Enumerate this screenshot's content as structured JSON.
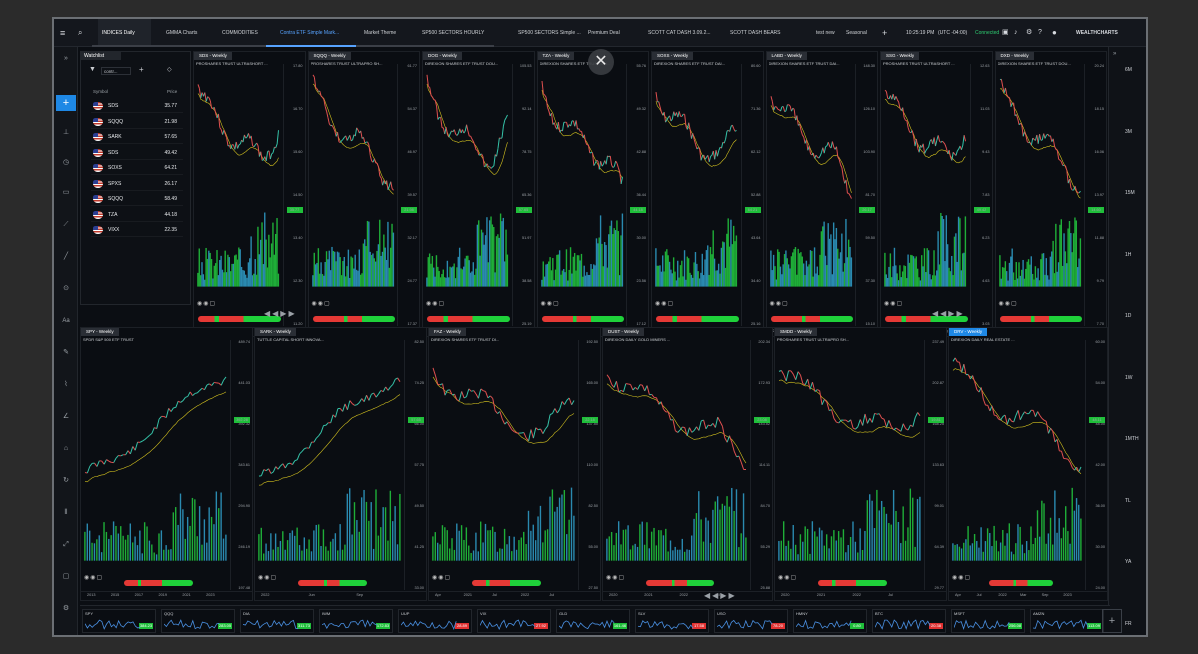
{
  "topbar": {
    "tabs": [
      "INDICES Daily",
      "GMMA Charts",
      "COMMODITIES",
      "Contra ETF Simple Mark...",
      "Market Theme",
      "SP500 SECTORS HOURLY",
      "SP500 SECTORS Simple ...",
      "Premium Deal",
      "SCOTT CAT DASH 3.09.2...",
      "SCOTT DASH BEARS",
      "test new",
      "Seasonal"
    ],
    "selected_tab": "Contra ETF Simple Mark...",
    "time": "10:25:19 PM",
    "timezone": "(UTC -04:00)",
    "status": "Connected",
    "brand": "WEALTHCHARTS"
  },
  "watchlist": {
    "title": "Watchlist",
    "list_name": "contr...",
    "col_symbol": "Symbol",
    "col_price": "Price",
    "rows": [
      {
        "symbol": "SDS",
        "price": "35.77"
      },
      {
        "symbol": "SQQQ",
        "price": "21.98"
      },
      {
        "symbol": "SARK",
        "price": "57.65"
      },
      {
        "symbol": "SDS",
        "price": "49.42"
      },
      {
        "symbol": "SOXS",
        "price": "64.21"
      },
      {
        "symbol": "SPXS",
        "price": "26.17"
      },
      {
        "symbol": "SQQQ",
        "price": "58.49"
      },
      {
        "symbol": "TZA",
        "price": "44.18"
      },
      {
        "symbol": "VIXX",
        "price": "22.35"
      }
    ]
  },
  "timeframes": [
    "6M",
    "3M",
    "15M",
    "1H",
    "1D",
    "1W",
    "1MTH",
    "TL",
    "YA",
    "FR"
  ],
  "panels_top": [
    {
      "tab": "SDS - Weekly",
      "name": "PROSHARES TRUST ULTRASHORT ...",
      "last": "35.77",
      "xlabels": [
        "2021",
        "2022",
        "Sep"
      ],
      "yticks": [
        "17.80",
        "16.70",
        "15.60",
        "14.50",
        "13.40",
        "12.30",
        "11.20"
      ]
    },
    {
      "tab": "SQQQ - Weekly",
      "name": "PROSHARES TRUST ULTRAPRO SH...",
      "last": "21.98",
      "xlabels": [
        "Mar",
        "Jul"
      ],
      "yticks": [
        "61.77",
        "54.37",
        "46.97",
        "39.57",
        "32.17",
        "24.77",
        "17.37"
      ]
    },
    {
      "tab": "DOG - Weekly",
      "name": "DIREXION SHARES ETF TRUST DOU...",
      "last": "57.65",
      "xlabels": [
        "2021",
        "2022",
        "Sep"
      ],
      "yticks": [
        "105.53",
        "92.14",
        "78.75",
        "65.36",
        "51.97",
        "38.58",
        "25.19"
      ]
    },
    {
      "tab": "TZA - Weekly",
      "name": "DIREXION SHARES ETF TRUST DAI...",
      "last": "44.18",
      "xlabels": [
        "Apr",
        "Jul"
      ],
      "yticks": [
        "55.76",
        "49.32",
        "42.88",
        "36.44",
        "30.00",
        "23.56",
        "17.12"
      ]
    },
    {
      "tab": "SOXS - Weekly",
      "name": "DIREXION SHARES ETF TRUST DAI...",
      "last": "64.21",
      "xlabels": [
        "Jul",
        "Nov"
      ],
      "yticks": [
        "80.60",
        "71.36",
        "62.12",
        "52.88",
        "43.64",
        "34.40",
        "25.16"
      ]
    },
    {
      "tab": "LABD - Weekly",
      "name": "DIREXION SHARES ETF TRUST DAI...",
      "last": "26.17",
      "xlabels": [
        "2021",
        "2022"
      ],
      "yticks": [
        "148.30",
        "126.10",
        "103.90",
        "81.70",
        "59.50",
        "37.30",
        "15.10"
      ]
    },
    {
      "tab": "SSG - Weekly",
      "name": "PROSHARES TRUST ULTRASHORT ...",
      "last": "49.42",
      "xlabels": [
        "2021",
        "2022",
        "Sep"
      ],
      "yticks": [
        "12.63",
        "11.03",
        "9.43",
        "7.83",
        "6.23",
        "4.63",
        "3.03"
      ]
    },
    {
      "tab": "DXD - Weekly",
      "name": "DIREXION SHARES ETF TRUST DOU...",
      "last": "14.60",
      "xlabels": [
        "2021",
        "2022",
        "Sep"
      ],
      "yticks": [
        "20.24",
        "18.15",
        "16.06",
        "13.97",
        "11.88",
        "9.79",
        "7.70"
      ]
    }
  ],
  "panels_bottom": [
    {
      "tab": "SPY - Weekly",
      "name": "SPDR S&P 500 ETF TRUST",
      "last": "392.28",
      "xlabels": [
        "2013",
        "2015",
        "2017",
        "2019",
        "2021",
        "2023"
      ],
      "yticks": [
        "489.74",
        "441.03",
        "392.32",
        "343.61",
        "294.90",
        "246.19",
        "197.48"
      ]
    },
    {
      "tab": "SARK - Weekly",
      "name": "TUTTLE CAPITAL SHORT INNOVA...",
      "last": "57.65",
      "xlabels": [
        "2022",
        "Jun",
        "Sep"
      ],
      "yticks": [
        "82.50",
        "74.25",
        "66.00",
        "57.75",
        "49.50",
        "41.25",
        "33.00"
      ]
    },
    {
      "tab": "FAZ - Weekly",
      "name": "DIREXION SHARES ETF TRUST DI...",
      "last": "22.18",
      "xlabels": [
        "Apr",
        "2021",
        "Jul",
        "2022",
        "Jul"
      ],
      "yticks": [
        "192.50",
        "165.00",
        "137.50",
        "110.00",
        "82.50",
        "55.00",
        "27.50"
      ]
    },
    {
      "tab": "DUST - Weekly",
      "name": "DIREXION DAILY GOLD MINERS ...",
      "last": "23.08",
      "xlabels": [
        "2020",
        "2021",
        "2022",
        "Jul"
      ],
      "yticks": [
        "202.34",
        "172.93",
        "143.52",
        "114.11",
        "84.70",
        "55.29",
        "25.88"
      ]
    },
    {
      "tab": "SMDD - Weekly",
      "name": "PROSHARES TRUST ULTRAPRO SH...",
      "last": "19.81",
      "xlabels": [
        "2020",
        "2021",
        "2022",
        "Jul"
      ],
      "yticks": [
        "237.49",
        "202.87",
        "168.25",
        "133.63",
        "99.01",
        "64.39",
        "29.77"
      ]
    },
    {
      "tab": "DRV - Weekly",
      "name": "DIREXION DAILY REAL ESTATE ...",
      "last": "48.11",
      "xlabels": [
        "Apr",
        "Jul",
        "2022",
        "Mar",
        "Sep",
        "2023"
      ],
      "yticks": [
        "60.00",
        "54.00",
        "48.00",
        "42.00",
        "36.00",
        "30.00",
        "24.00"
      ]
    }
  ],
  "bottom_tickers": [
    {
      "sym": "SPY",
      "val": "384.23",
      "red": false
    },
    {
      "sym": "QQQ",
      "val": "283.05",
      "red": false
    },
    {
      "sym": "DIA",
      "val": "311.73",
      "red": false
    },
    {
      "sym": "IWM",
      "val": "172.83",
      "red": false
    },
    {
      "sym": "UUP",
      "val": "28.89",
      "red": true
    },
    {
      "sym": "VIX",
      "val": "27.92",
      "red": true
    },
    {
      "sym": "GLD",
      "val": "161.46",
      "red": false
    },
    {
      "sym": "SLV",
      "val": "17.58",
      "red": true
    },
    {
      "sym": "USO",
      "val": "78.20",
      "red": true
    },
    {
      "sym": "HMNY",
      "val": "0.80",
      "red": false
    },
    {
      "sym": "BTC",
      "val": "20.38",
      "red": true
    },
    {
      "sym": "MSFT",
      "val": "256.08",
      "red": false
    },
    {
      "sym": "AMZN",
      "val": "113.09",
      "red": false
    }
  ]
}
